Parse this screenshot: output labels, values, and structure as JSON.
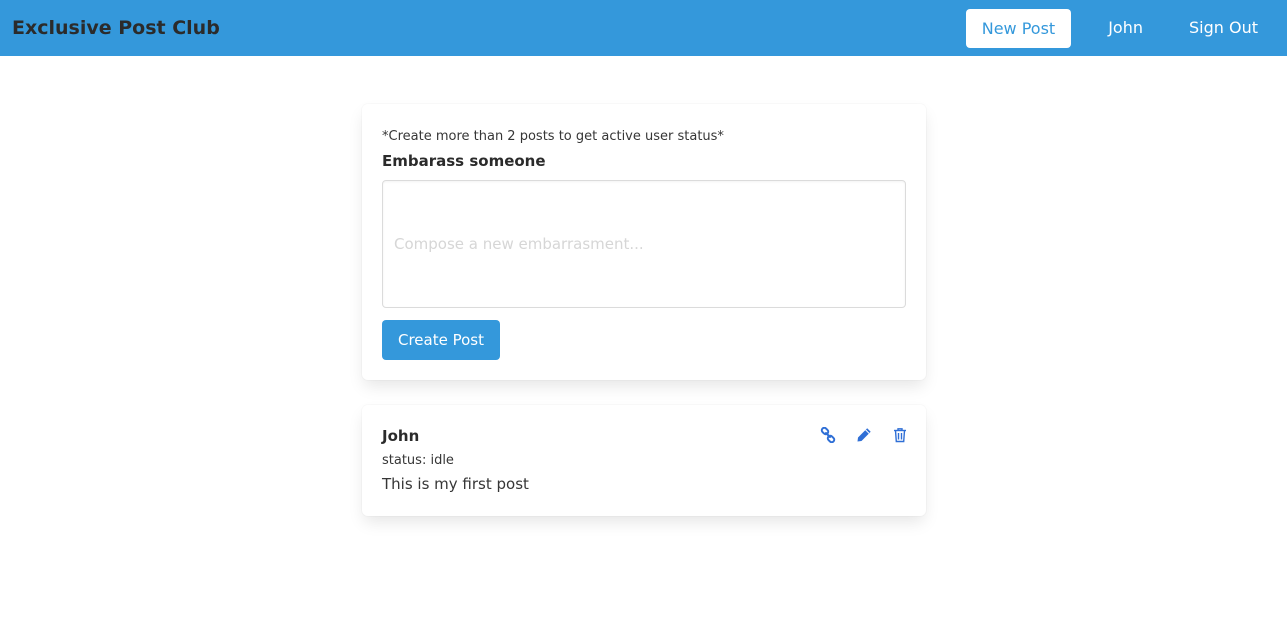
{
  "navbar": {
    "brand": "Exclusive Post Club",
    "new_post_label": "New Post",
    "user_label": "John",
    "sign_out_label": "Sign Out"
  },
  "compose": {
    "hint": "*Create more than 2 posts to get active user status*",
    "label": "Embarass someone",
    "placeholder": "Compose a new embarrasment...",
    "value": "",
    "submit_label": "Create Post"
  },
  "posts": [
    {
      "author": "John",
      "status": "status: idle",
      "body": "This is my first post",
      "actions": [
        "link-icon",
        "pencil-icon",
        "trash-icon"
      ]
    }
  ],
  "colors": {
    "primary": "#3498db",
    "icon": "#2f6fd6",
    "text": "#363636"
  }
}
